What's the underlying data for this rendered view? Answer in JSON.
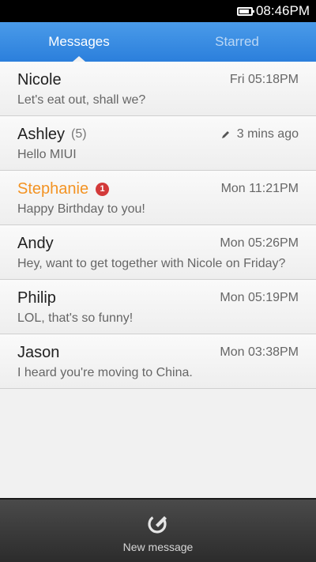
{
  "status_bar": {
    "time": "08:46PM",
    "battery_level": 0.85,
    "icons": [
      "battery-icon"
    ]
  },
  "tabs": [
    {
      "label": "Messages",
      "active": true
    },
    {
      "label": "Starred",
      "active": false
    }
  ],
  "conversations": [
    {
      "name": "Nicole",
      "count": "",
      "badge": "",
      "time": "Fri 05:18PM",
      "preview": "Let's eat out, shall we?",
      "unread": false,
      "draft": false
    },
    {
      "name": "Ashley",
      "count": "(5)",
      "badge": "",
      "time": "3 mins ago",
      "preview": "Hello MIUI",
      "unread": false,
      "draft": true
    },
    {
      "name": "Stephanie",
      "count": "",
      "badge": "1",
      "time": "Mon 11:21PM",
      "preview": "Happy Birthday to you!",
      "unread": true,
      "draft": false
    },
    {
      "name": "Andy",
      "count": "",
      "badge": "",
      "time": "Mon 05:26PM",
      "preview": "Hey, want to get together with Nicole on Friday?",
      "unread": false,
      "draft": false
    },
    {
      "name": "Philip",
      "count": "",
      "badge": "",
      "time": "Mon 05:19PM",
      "preview": "LOL, that's so funny!",
      "unread": false,
      "draft": false
    },
    {
      "name": "Jason",
      "count": "",
      "badge": "",
      "time": "Mon 03:38PM",
      "preview": "I heard you're moving to China.",
      "unread": false,
      "draft": false
    }
  ],
  "bottom_bar": {
    "label": "New message",
    "icon": "compose-icon"
  },
  "colors": {
    "accent": "#2b7fdc",
    "unread_name": "#f39323",
    "badge": "#d33a3a"
  }
}
